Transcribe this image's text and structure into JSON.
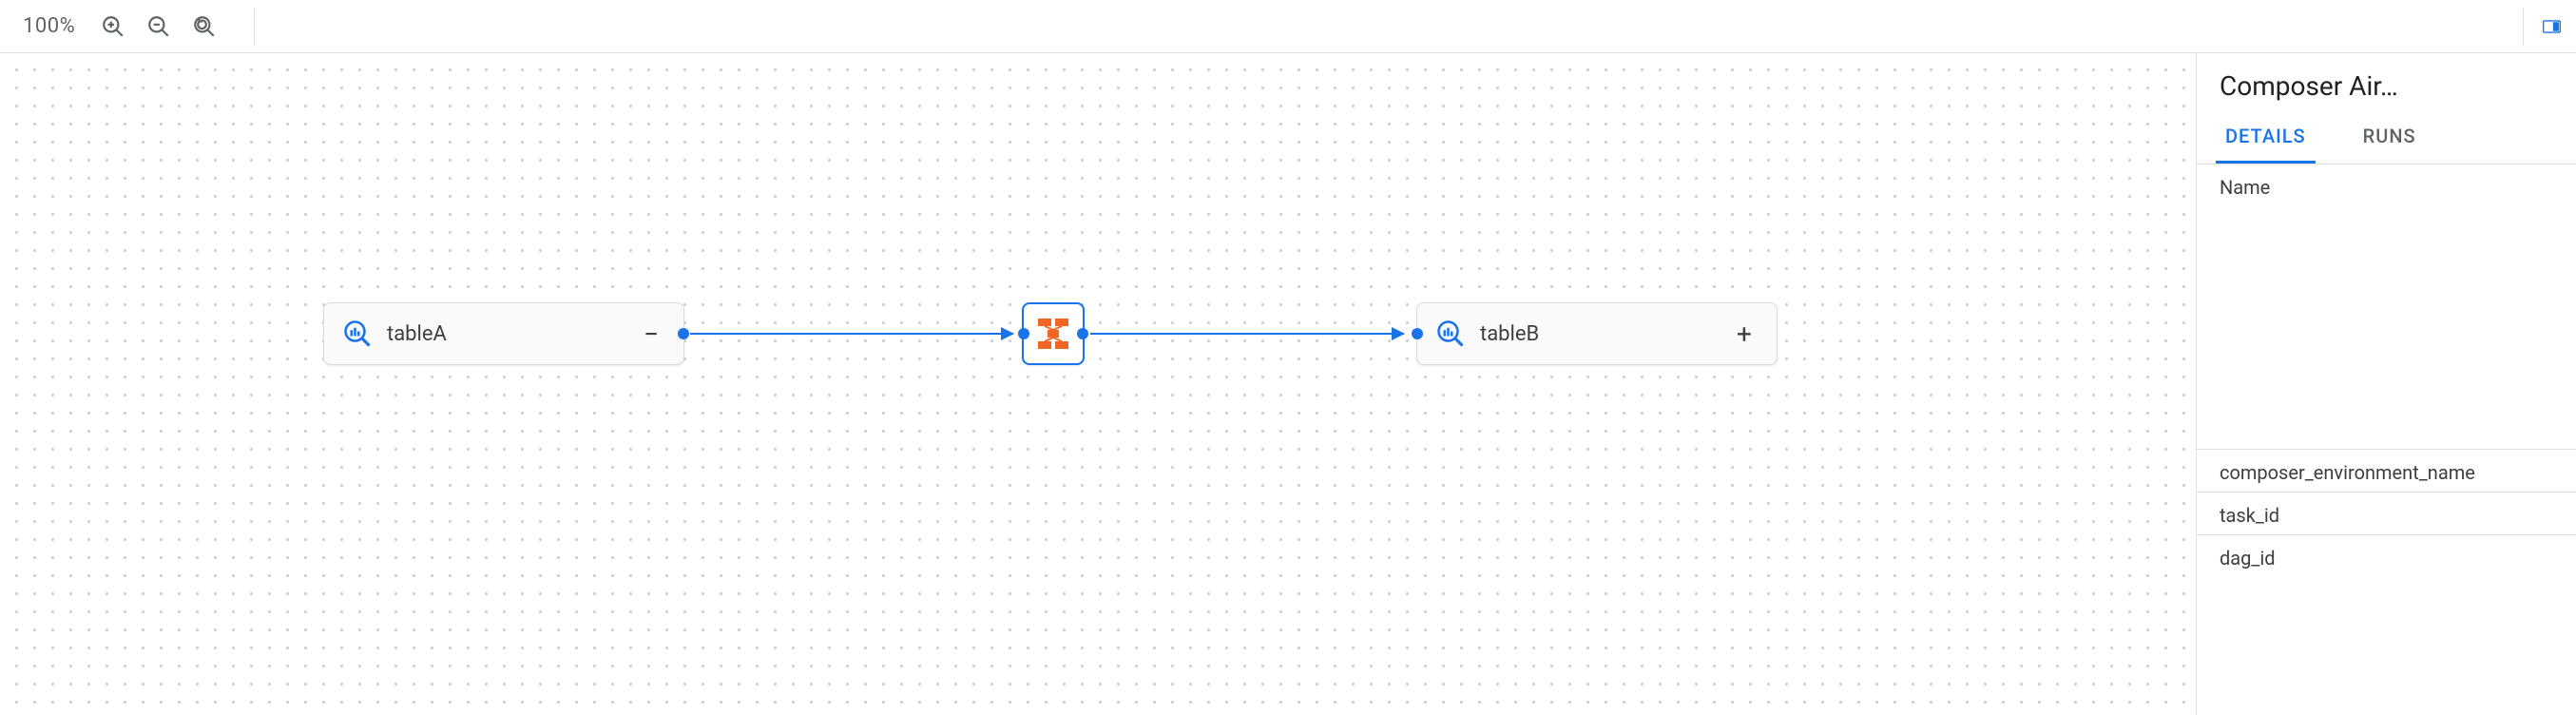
{
  "toolbar": {
    "zoom_level": "100%"
  },
  "canvas": {
    "node_a": {
      "label": "tableA",
      "expand_glyph": "−"
    },
    "node_center": {
      "icon": "dataform"
    },
    "node_b": {
      "label": "tableB",
      "expand_glyph": "+"
    }
  },
  "sidepanel": {
    "title": "Composer Air…",
    "tabs": {
      "details": "DETAILS",
      "runs": "RUNS"
    },
    "fields": {
      "name_label": "Name",
      "env_label": "composer_environment_name",
      "task_label": "task_id",
      "dag_label": "dag_id"
    }
  }
}
